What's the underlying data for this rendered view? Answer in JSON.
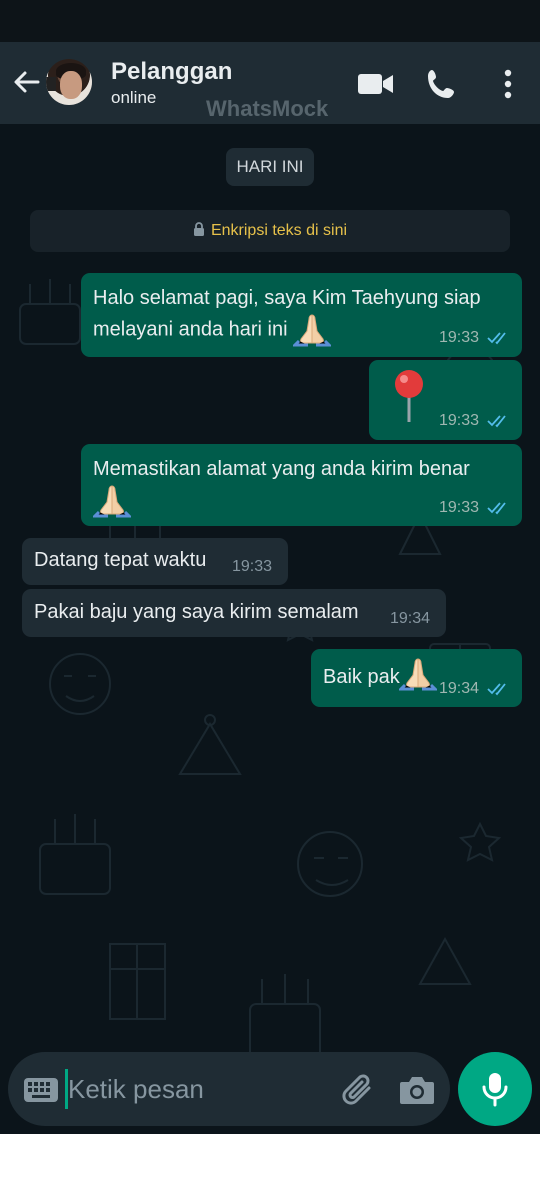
{
  "header": {
    "contact_name": "Pelanggan",
    "contact_status": "online",
    "watermark": "WhatsMock",
    "icons": [
      "back-arrow-icon",
      "video-call-icon",
      "phone-icon",
      "more-options-icon"
    ]
  },
  "chat": {
    "date_chip": "HARI INI",
    "encryption_notice": "Enkripsi teks di sini",
    "messages": [
      {
        "direction": "outgoing",
        "line1": "Halo selamat pagi, saya Kim Taehyung siap",
        "line2": "melayani anda hari ini",
        "emoji": "folded-hands",
        "time": "19:33",
        "status": "read"
      },
      {
        "direction": "outgoing",
        "emoji": "round-pushpin",
        "time": "19:33",
        "status": "read"
      },
      {
        "direction": "outgoing",
        "line1": "Memastikan alamat yang anda kirim benar",
        "emoji": "folded-hands",
        "time": "19:33",
        "status": "read"
      },
      {
        "direction": "incoming",
        "text": "Datang tepat waktu",
        "time": "19:33"
      },
      {
        "direction": "incoming",
        "text": "Pakai baju yang saya kirim semalam",
        "time": "19:34"
      },
      {
        "direction": "outgoing",
        "text": "Baik pak",
        "emoji": "folded-hands",
        "time": "19:34",
        "status": "read"
      }
    ]
  },
  "composer": {
    "placeholder": "Ketik pesan",
    "icons": [
      "keyboard-icon",
      "attach-icon",
      "camera-icon",
      "mic-icon"
    ]
  },
  "colors": {
    "header_bg": "#1f2c34",
    "chat_bg": "#0b141a",
    "outgoing_bubble": "#005c4b",
    "incoming_bubble": "#1f2c34",
    "accent": "#00a884",
    "read_ticks": "#53bdeb",
    "encryption_text": "#e6c14a"
  }
}
